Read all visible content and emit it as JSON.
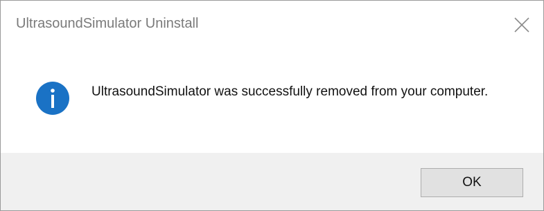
{
  "window": {
    "title": "UltrasoundSimulator Uninstall",
    "close_icon": "close-icon"
  },
  "content": {
    "icon": "info-icon",
    "icon_color": "#1a72c5",
    "message": "UltrasoundSimulator was successfully removed from your computer."
  },
  "footer": {
    "ok_label": "OK"
  }
}
